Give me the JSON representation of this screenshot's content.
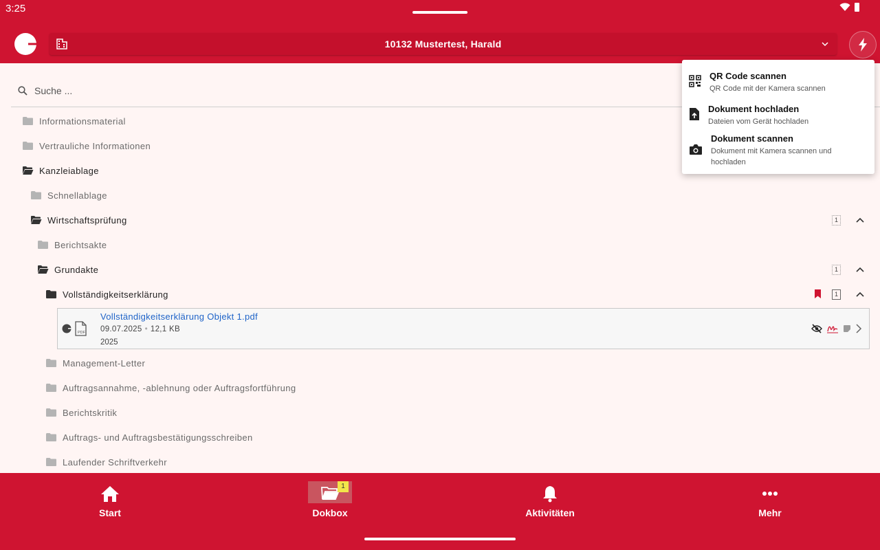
{
  "status": {
    "time": "3:25"
  },
  "header": {
    "client": "10132 Mustertest, Harald"
  },
  "search": {
    "placeholder": "Suche ..."
  },
  "tree": [
    {
      "label": "Informationsmaterial"
    },
    {
      "label": "Vertrauliche Informationen"
    },
    {
      "label": "Kanzleiablage"
    },
    {
      "label": "Schnellablage"
    },
    {
      "label": "Wirtschaftsprüfung",
      "count": "1"
    },
    {
      "label": "Berichtsakte"
    },
    {
      "label": "Grundakte",
      "count": "1"
    },
    {
      "label": "Vollständigkeitserklärung",
      "count": "1"
    },
    {
      "label": "Management-Letter"
    },
    {
      "label": "Auftragsannahme, -ablehnung oder Auftragsfortführung"
    },
    {
      "label": "Berichtskritik"
    },
    {
      "label": "Auftrags- und Auftragsbestätigungsschreiben"
    },
    {
      "label": "Laufender Schriftverkehr"
    }
  ],
  "document": {
    "title": "Vollständigkeitserklärung Objekt 1.pdf",
    "date": "09.07.2025",
    "separator": "•",
    "size": "12,1 KB",
    "year": "2025",
    "file_type": "PDF"
  },
  "quick_menu": [
    {
      "title": "QR Code scannen",
      "subtitle": "QR Code mit der Kamera scannen",
      "icon": "qr-code-icon"
    },
    {
      "title": "Dokument hochladen",
      "subtitle": "Dateien vom Gerät hochladen",
      "icon": "file-upload-icon"
    },
    {
      "title": "Dokument scannen",
      "subtitle": "Dokument mit Kamera scannen und hochladen",
      "icon": "camera-icon"
    }
  ],
  "nav": [
    {
      "label": "Start"
    },
    {
      "label": "Dokbox",
      "badge": "1"
    },
    {
      "label": "Aktivitäten"
    },
    {
      "label": "Mehr"
    }
  ],
  "colors": {
    "brand": "#cf1431",
    "background": "#fff5f4",
    "link": "#1e63c8",
    "badge": "#f2e54a"
  }
}
